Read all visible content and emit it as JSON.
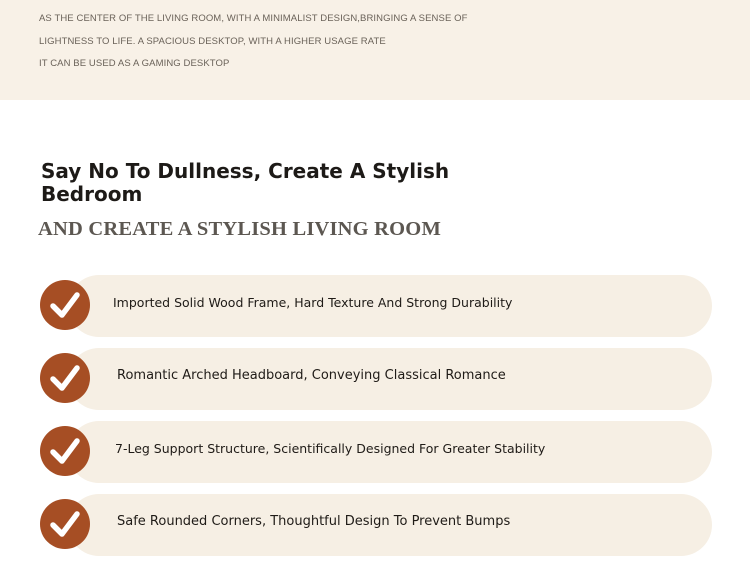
{
  "top_banner": {
    "lines": [
      "AS THE CENTER OF THE LIVING ROOM, WITH A MINIMALIST DESIGN,BRINGING A SENSE OF",
      "LIGHTNESS TO LIFE. A SPACIOUS DESKTOP, WITH A HIGHER USAGE RATE",
      "IT CAN BE USED AS A GAMING DESKTOP"
    ]
  },
  "heading": "Say No To Dullness, Create A Stylish Bedroom",
  "subheading": "AND CREATE A STYLISH LIVING ROOM",
  "colors": {
    "accent": "#a64e24",
    "pill_background": "#f6efe4",
    "banner_background": "#f8f1e7"
  },
  "features": [
    {
      "icon": "check-icon",
      "label": "Imported Solid Wood Frame, Hard Texture And Strong Durability"
    },
    {
      "icon": "check-icon",
      "label": "Romantic Arched Headboard, Conveying Classical Romance"
    },
    {
      "icon": "check-icon",
      "label": "7-Leg Support Structure, Scientifically Designed For Greater Stability"
    },
    {
      "icon": "check-icon",
      "label": "Safe Rounded Corners, Thoughtful Design To Prevent Bumps"
    }
  ]
}
